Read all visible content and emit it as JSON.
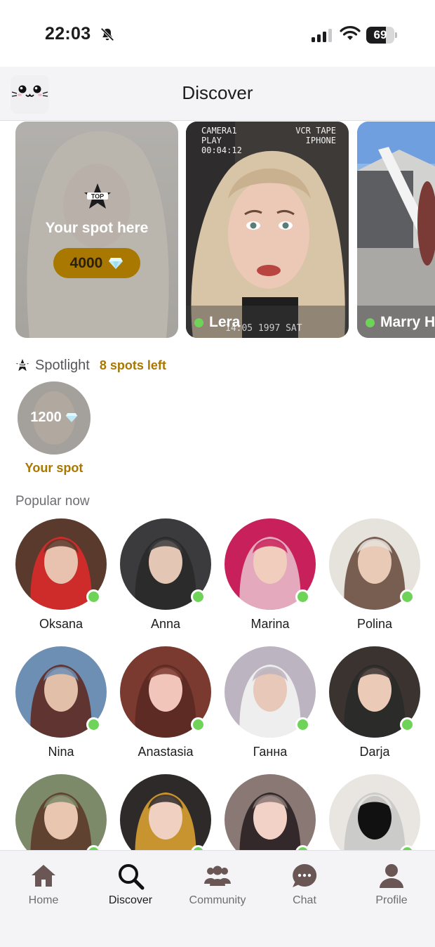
{
  "status_bar": {
    "time": "22:03",
    "battery": "69",
    "battery_level": 0.69
  },
  "header": {
    "title": "Discover",
    "logo_icon": "cat-face-icon"
  },
  "featured": {
    "promo": {
      "text": "Your spot here",
      "price": "4000",
      "badge_icon": "top-star-icon"
    },
    "cards": [
      {
        "name": "Lera",
        "vcr_left": [
          "CAMERA1",
          "PLAY",
          "00:04:12"
        ],
        "vcr_right": [
          "VCR TAPE",
          "IPHONE"
        ],
        "stamp": "14:05 1997 SAT"
      },
      {
        "name": "Marry H"
      }
    ]
  },
  "spotlight": {
    "title": "Spotlight",
    "spots_left": "8 spots left",
    "my_spot_price": "1200",
    "my_spot_label": "Your spot"
  },
  "popular": {
    "title": "Popular now",
    "people": [
      {
        "name": "Oksana"
      },
      {
        "name": "Anna"
      },
      {
        "name": "Marina"
      },
      {
        "name": "Polina"
      },
      {
        "name": "Nina"
      },
      {
        "name": "Anastasia"
      },
      {
        "name": "Ганна"
      },
      {
        "name": "Darja"
      },
      {
        "name": ""
      },
      {
        "name": ""
      },
      {
        "name": ""
      },
      {
        "name": ""
      }
    ]
  },
  "tabs": [
    {
      "label": "Home",
      "icon": "home-icon"
    },
    {
      "label": "Discover",
      "icon": "search-icon",
      "active": true
    },
    {
      "label": "Community",
      "icon": "community-icon"
    },
    {
      "label": "Chat",
      "icon": "chat-bubble-icon"
    },
    {
      "label": "Profile",
      "icon": "profile-icon"
    }
  ],
  "colors": {
    "accent_gold": "#a87800",
    "online": "#6fd35a",
    "tab_icon": "#6b5656"
  }
}
